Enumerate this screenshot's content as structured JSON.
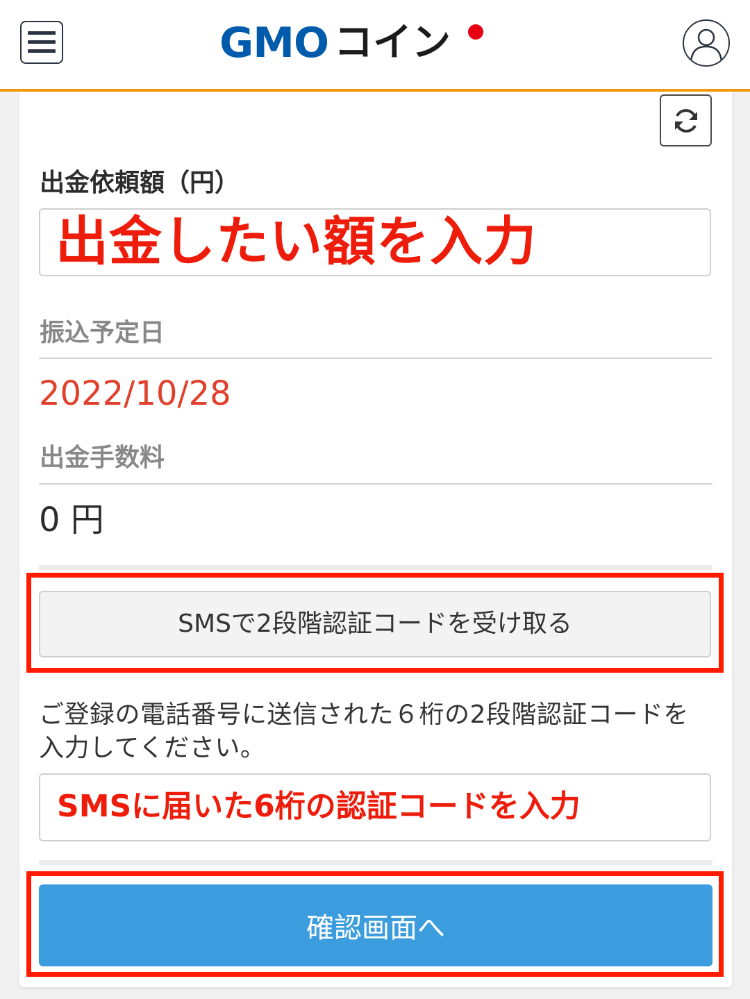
{
  "header": {
    "logo_gmo": "GMO",
    "logo_coin": "コイン"
  },
  "form": {
    "amount_label": "出金依頼額（円）",
    "amount_overlay": "出金したい額を入力",
    "transfer_date_label": "振込予定日",
    "transfer_date_value": "2022/10/28",
    "fee_label": "出金手数料",
    "fee_value": "0 円",
    "sms_button_label": "SMSで2段階認証コードを受け取る",
    "sms_instruction": "ご登録の電話番号に送信された６桁の2段階認証コードを入力してください。",
    "code_overlay": "SMSに届いた6桁の認証コードを入力",
    "confirm_button_label": "確認画面へ"
  },
  "colors": {
    "brand_blue": "#005bac",
    "header_accent": "#f39800",
    "date_red": "#e0402c",
    "annotation_red": "#ff1a00",
    "confirm_blue": "#3b9ddd"
  },
  "icons": [
    "menu-icon",
    "user-icon",
    "refresh-icon"
  ]
}
